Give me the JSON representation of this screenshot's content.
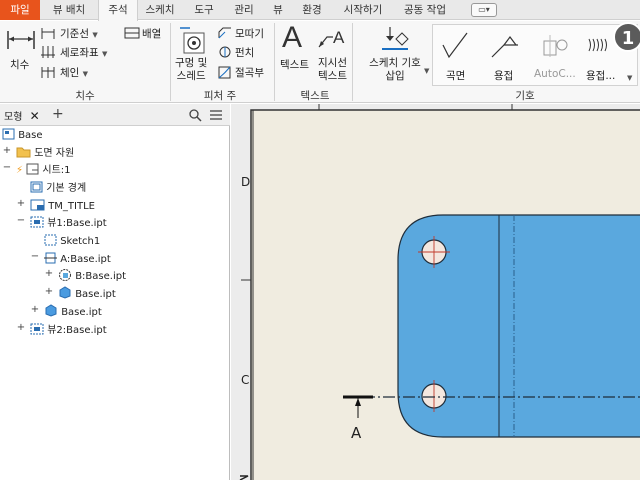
{
  "tabs": [
    "파일",
    "뷰 배치",
    "주석",
    "스케치",
    "도구",
    "관리",
    "뷰",
    "환경",
    "시작하기",
    "공동 작업"
  ],
  "ribbon": {
    "dimension": {
      "big_label": "치수",
      "baseline": "기준선",
      "ordinate": "세로좌표",
      "chain": "체인",
      "arrange": "배열",
      "panel": "치수"
    },
    "feature_notes": {
      "hole_thread_line1": "구멍 및",
      "hole_thread_line2": "스레드",
      "chamfer": "모따기",
      "punch": "펀치",
      "bend": "절곡부",
      "panel": "피처 주"
    },
    "text": {
      "text": "텍스트",
      "leader_line1": "지시선",
      "leader_line2": "텍스트",
      "panel": "텍스트"
    },
    "symbols": {
      "insert_line1": "스케치 기호",
      "insert_line2": "삽입",
      "surface": "곡면",
      "weld": "용접",
      "autoc": "AutoC...",
      "weld2": "용접...",
      "panel": "기호"
    }
  },
  "browser": {
    "tab_label": "모형",
    "add": "+",
    "items": [
      {
        "label": "Base"
      },
      {
        "label": "도면 자원"
      },
      {
        "label": "시트:1"
      },
      {
        "label": "기본 경계"
      },
      {
        "label": "TM_TITLE"
      },
      {
        "label": "뷰1:Base.ipt"
      },
      {
        "label": "Sketch1"
      },
      {
        "label": "A:Base.ipt"
      },
      {
        "label": "B:Base.ipt"
      },
      {
        "label": "Base.ipt"
      },
      {
        "label": "Base.ipt"
      },
      {
        "label": "뷰2:Base.ipt"
      }
    ]
  },
  "canvas": {
    "zone_d": "D",
    "zone_c": "C",
    "section_label": "A"
  },
  "badge": "1",
  "colors": {
    "file_tab": "#e8541c",
    "part_fill": "#5aa8de",
    "part_edge": "#1f2d3a",
    "sheet": "#f0ece0"
  }
}
